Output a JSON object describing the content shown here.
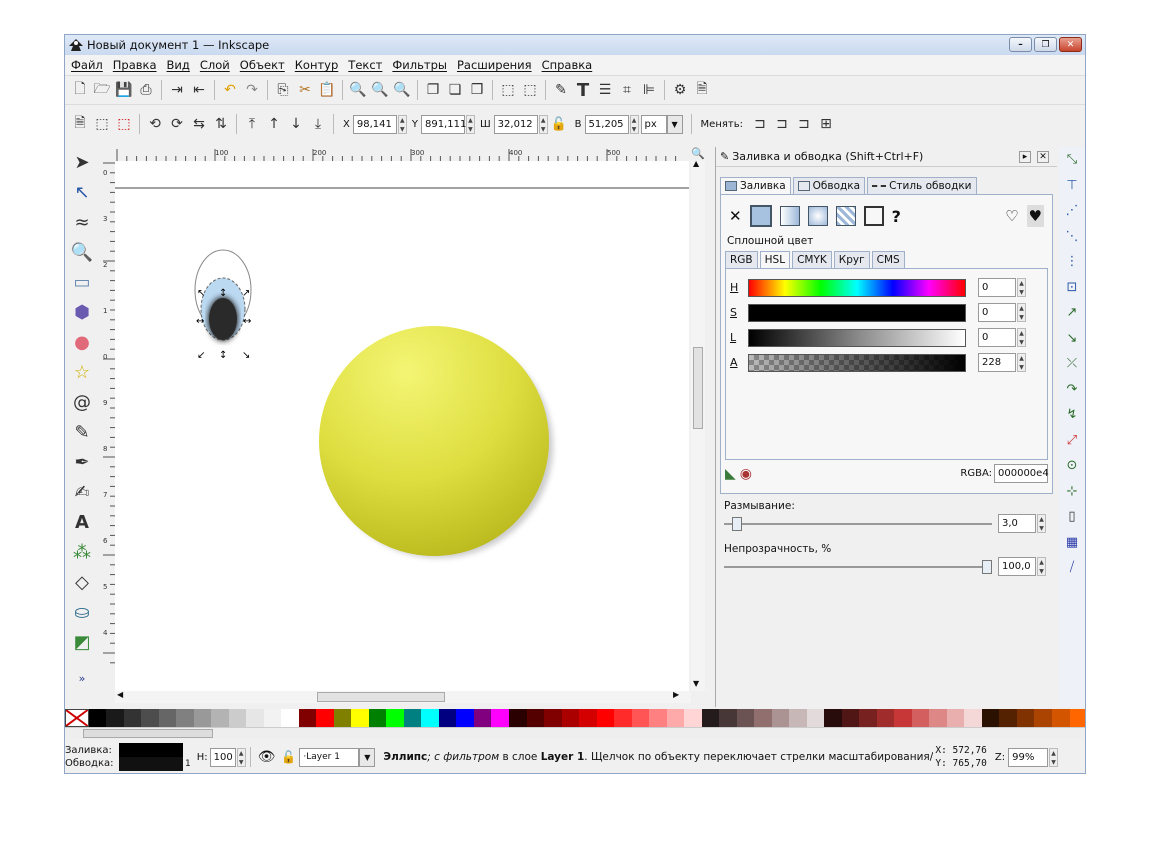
{
  "window": {
    "title": "Новый документ 1 — Inkscape",
    "min_label": "–",
    "max_label": "❐",
    "close_label": "✕"
  },
  "menu": [
    "Файл",
    "Правка",
    "Вид",
    "Слой",
    "Объект",
    "Контур",
    "Текст",
    "Фильтры",
    "Расширения",
    "Справка"
  ],
  "toolbar": {
    "x_label": "X",
    "x_value": "98,141",
    "y_label": "Y",
    "y_value": "891,111",
    "w_label": "Ш",
    "w_value": "32,012",
    "h_label": "В",
    "h_value": "51,205",
    "unit": "px",
    "change_label": "Менять:"
  },
  "panel": {
    "title": "Заливка и обводка (Shift+Ctrl+F)",
    "tabs": [
      "Заливка",
      "Обводка",
      "Стиль обводки"
    ],
    "flat_color_label": "Сплошной цвет",
    "mode_tabs": [
      "RGB",
      "HSL",
      "CMYK",
      "Круг",
      "CMS"
    ],
    "channels": [
      {
        "name": "H",
        "value": "0"
      },
      {
        "name": "S",
        "value": "0"
      },
      {
        "name": "L",
        "value": "0"
      },
      {
        "name": "A",
        "value": "228"
      }
    ],
    "rgba_label": "RGBA:",
    "rgba_value": "000000e4",
    "blur_label": "Размывание:",
    "blur_value": "3,0",
    "blur_level": 0.03,
    "opacity_label": "Непрозрачность, %",
    "opacity_value": "100,0",
    "opacity_level": 1.0
  },
  "ruler": {
    "top": [
      "100",
      "200",
      "300",
      "400",
      "500"
    ],
    "left": [
      "0",
      "3",
      "2",
      "1",
      "0",
      "9",
      "8",
      "7",
      "6",
      "5",
      "4"
    ]
  },
  "status": {
    "fill_label": "Заливка:",
    "stroke_label": "Обводка:",
    "stroke_width": "1",
    "h_label": "H:",
    "h_value": "100",
    "layer": "Layer 1",
    "message_object": "Эллипс",
    "message_filter": "; с фильтром",
    "message_in_layer": " в слое ",
    "message_layer": "Layer 1",
    "message_rest": ". Щелчок по объекту переключает стрелки масштабирования/в",
    "coord_x_label": "X:",
    "coord_x": "572,76",
    "coord_y_label": "Y:",
    "coord_y": "765,70",
    "zoom_label": "Z:",
    "zoom_value": "99%"
  },
  "palette_colors": [
    "#000000",
    "#1a1a1a",
    "#333333",
    "#4d4d4d",
    "#666666",
    "#808080",
    "#999999",
    "#b3b3b3",
    "#cccccc",
    "#e6e6e6",
    "#f2f2f2",
    "#ffffff",
    "#800000",
    "#ff0000",
    "#808000",
    "#ffff00",
    "#008000",
    "#00ff00",
    "#008080",
    "#00ffff",
    "#000080",
    "#0000ff",
    "#800080",
    "#ff00ff",
    "#2b0000",
    "#550000",
    "#800000",
    "#aa0000",
    "#d40000",
    "#ff0000",
    "#ff2a2a",
    "#ff5555",
    "#ff8080",
    "#ffaaaa",
    "#ffd5d5",
    "#241c1c",
    "#483737",
    "#6c5353",
    "#916f6f",
    "#ac9393",
    "#c8b7b7",
    "#e3dbdb",
    "#280b0b",
    "#501616",
    "#782121",
    "#a02c2c",
    "#c83737",
    "#d35f5f",
    "#de8787",
    "#e9afaf",
    "#f4d7d7",
    "#2b1100",
    "#552200",
    "#803300",
    "#aa4400",
    "#d45500",
    "#ff6600"
  ]
}
